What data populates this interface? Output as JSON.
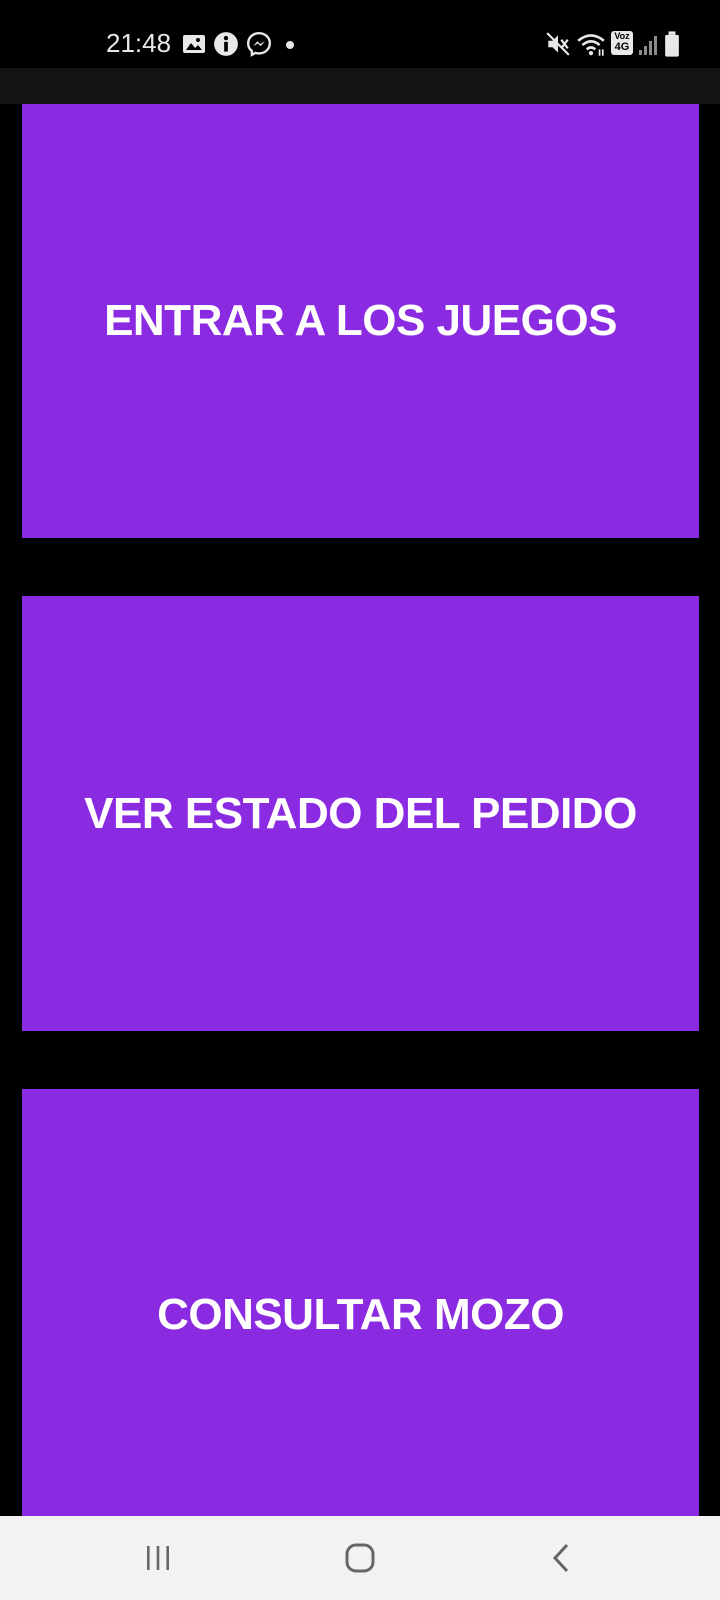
{
  "status_bar": {
    "time": "21:48",
    "icons": [
      "gallery-icon",
      "info-icon",
      "messenger-icon",
      "dot-icon",
      "mute-icon",
      "wifi-icon",
      "volte-icon",
      "signal-icon",
      "battery-icon"
    ],
    "volte_top": "Voz",
    "volte_bottom": "4G"
  },
  "buttons": [
    {
      "label": "ENTRAR A LOS JUEGOS"
    },
    {
      "label": "VER ESTADO DEL PEDIDO"
    },
    {
      "label": "CONSULTAR MOZO"
    }
  ],
  "colors": {
    "button_bg": "#8a2be2",
    "button_text": "#ffffff",
    "background": "#000000",
    "nav_bar": "#f2f2f2"
  },
  "nav_bar": {
    "icons": [
      "recent-apps-icon",
      "home-icon",
      "back-icon"
    ]
  }
}
